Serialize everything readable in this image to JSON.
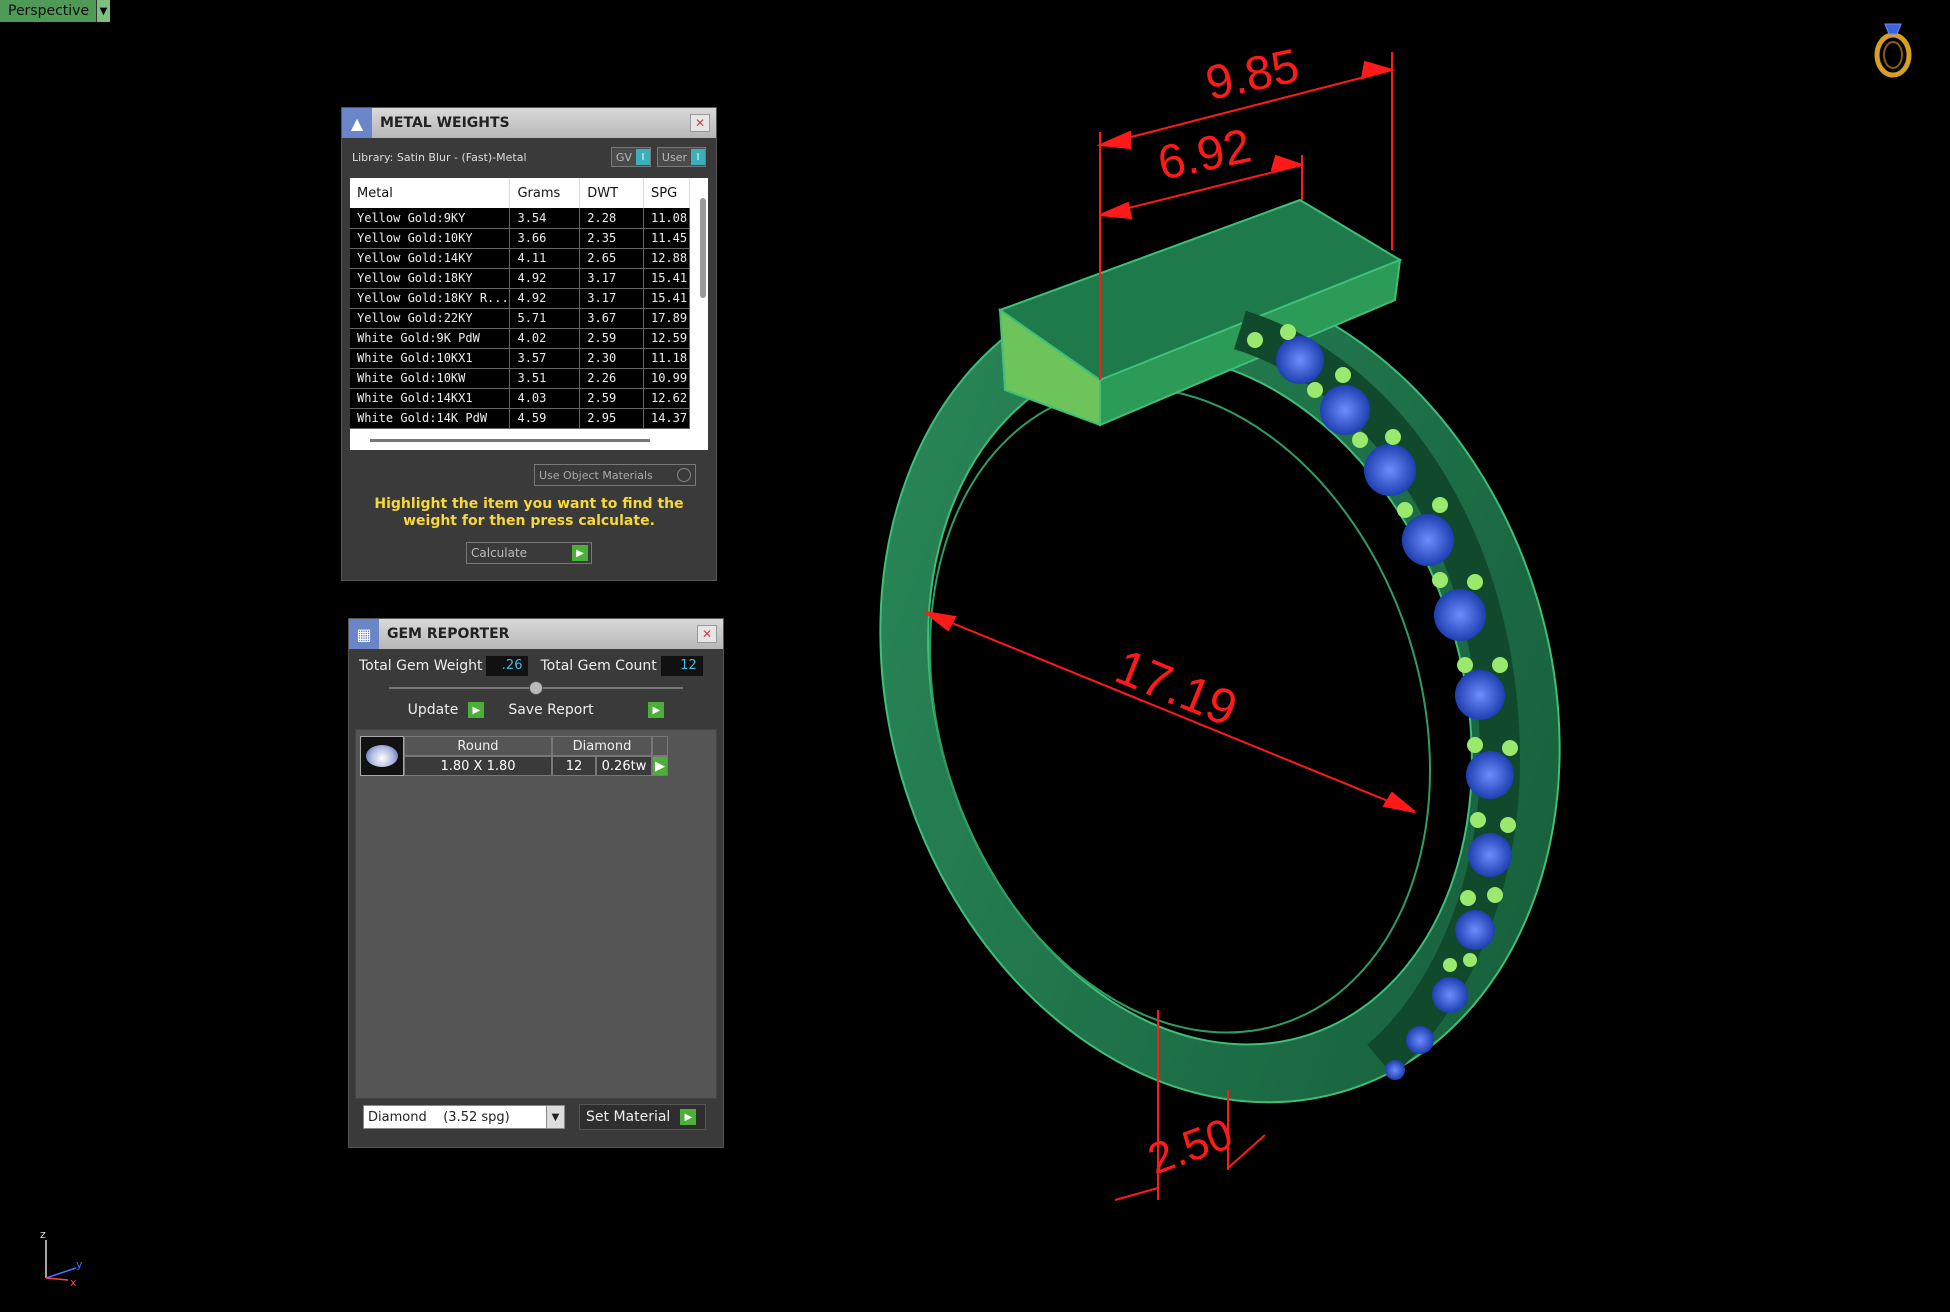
{
  "viewport": {
    "label": "Perspective"
  },
  "dimensions": {
    "outer_width": "9.85",
    "inner_width": "6.92",
    "diameter": "17.19",
    "band_width": "2.50"
  },
  "metal_weights": {
    "title": "METAL WEIGHTS",
    "library": "Library: Satin Blur - (Fast)-Metal",
    "gv_label": "GV",
    "user_label": "User",
    "columns": [
      "Metal",
      "Grams",
      "DWT",
      "SPG"
    ],
    "rows": [
      [
        "Yellow Gold:9KY",
        "3.54",
        "2.28",
        "11.08"
      ],
      [
        "Yellow Gold:10KY",
        "3.66",
        "2.35",
        "11.45"
      ],
      [
        "Yellow Gold:14KY",
        "4.11",
        "2.65",
        "12.88"
      ],
      [
        "Yellow Gold:18KY",
        "4.92",
        "3.17",
        "15.41"
      ],
      [
        "Yellow Gold:18KY R...",
        "4.92",
        "3.17",
        "15.41"
      ],
      [
        "Yellow Gold:22KY",
        "5.71",
        "3.67",
        "17.89"
      ],
      [
        "White Gold:9K PdW",
        "4.02",
        "2.59",
        "12.59"
      ],
      [
        "White Gold:10KX1",
        "3.57",
        "2.30",
        "11.18"
      ],
      [
        "White Gold:10KW",
        "3.51",
        "2.26",
        "10.99"
      ],
      [
        "White Gold:14KX1",
        "4.03",
        "2.59",
        "12.62"
      ],
      [
        "White Gold:14K PdW",
        "4.59",
        "2.95",
        "14.37"
      ]
    ],
    "use_object_materials": "Use Object Materials",
    "hint": "Highlight the item you want to find the weight for then press calculate.",
    "calculate": "Calculate"
  },
  "gem_reporter": {
    "title": "GEM REPORTER",
    "total_weight_label": "Total Gem Weight",
    "total_weight": ".26",
    "total_count_label": "Total Gem Count",
    "total_count": "12",
    "update": "Update",
    "save_report": "Save Report",
    "gem": {
      "shape": "Round",
      "type": "Diamond",
      "size": "1.80 X 1.80",
      "count": "12",
      "weight": "0.26tw"
    },
    "material": "Diamond    (3.52 spg)",
    "set_material": "Set Material"
  },
  "axes": {
    "z": "z",
    "y": "y",
    "x": "x"
  },
  "colors": {
    "ring": "#1f7a4c",
    "dim": "#ff1a1a",
    "gem": "#2d5bd6",
    "prong": "#8fe36a",
    "hint": "#f7d83a"
  }
}
